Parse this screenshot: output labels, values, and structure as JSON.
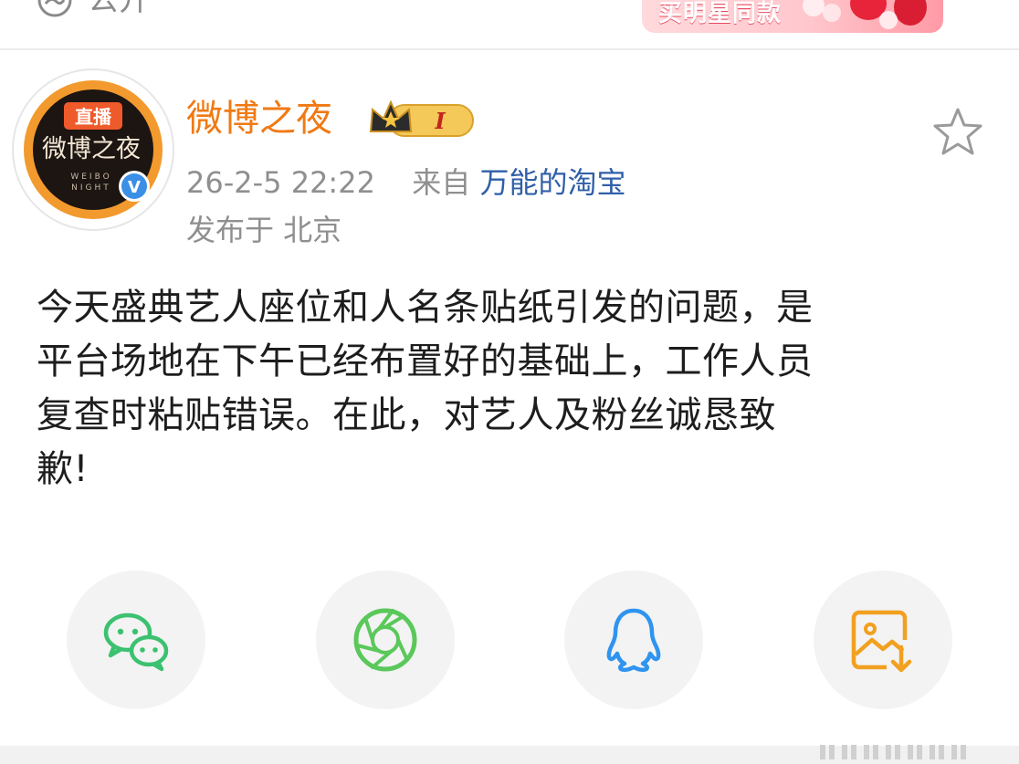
{
  "top": {
    "visibility_label": "公开",
    "promo_banner_text": "买明星同款"
  },
  "post": {
    "author": "微博之夜",
    "avatar": {
      "live_badge": "直播",
      "logo_text": "微博之夜",
      "logo_subtext_1": "WEIBO",
      "logo_subtext_2": "NIGHT",
      "verified_mark": "V"
    },
    "vip_level": "I",
    "timestamp": "26-2-5 22:22",
    "source_prefix": "来自",
    "source_app": "万能的淘宝",
    "location": "发布于 北京",
    "text_lines": [
      "今天盛典艺人座位和人名条贴纸引发的问题，是",
      "平台场地在下午已经布置好的基础上，工作人员",
      "复查时粘贴错误。在此，对艺人及粉丝诚恳致",
      "歉!"
    ]
  },
  "share": {
    "buttons": [
      {
        "icon": "wechat-icon"
      },
      {
        "icon": "moments-icon"
      },
      {
        "icon": "qq-icon"
      },
      {
        "icon": "save-image-icon"
      }
    ]
  },
  "colors": {
    "author": "#f07a14",
    "meta": "#8f8f8f",
    "link": "#2f5fa8",
    "body_text": "#1d1d1d",
    "wechat": "#3cc170",
    "moments": "#5ac85a",
    "qq": "#2f94f0",
    "save": "#f2a020"
  }
}
